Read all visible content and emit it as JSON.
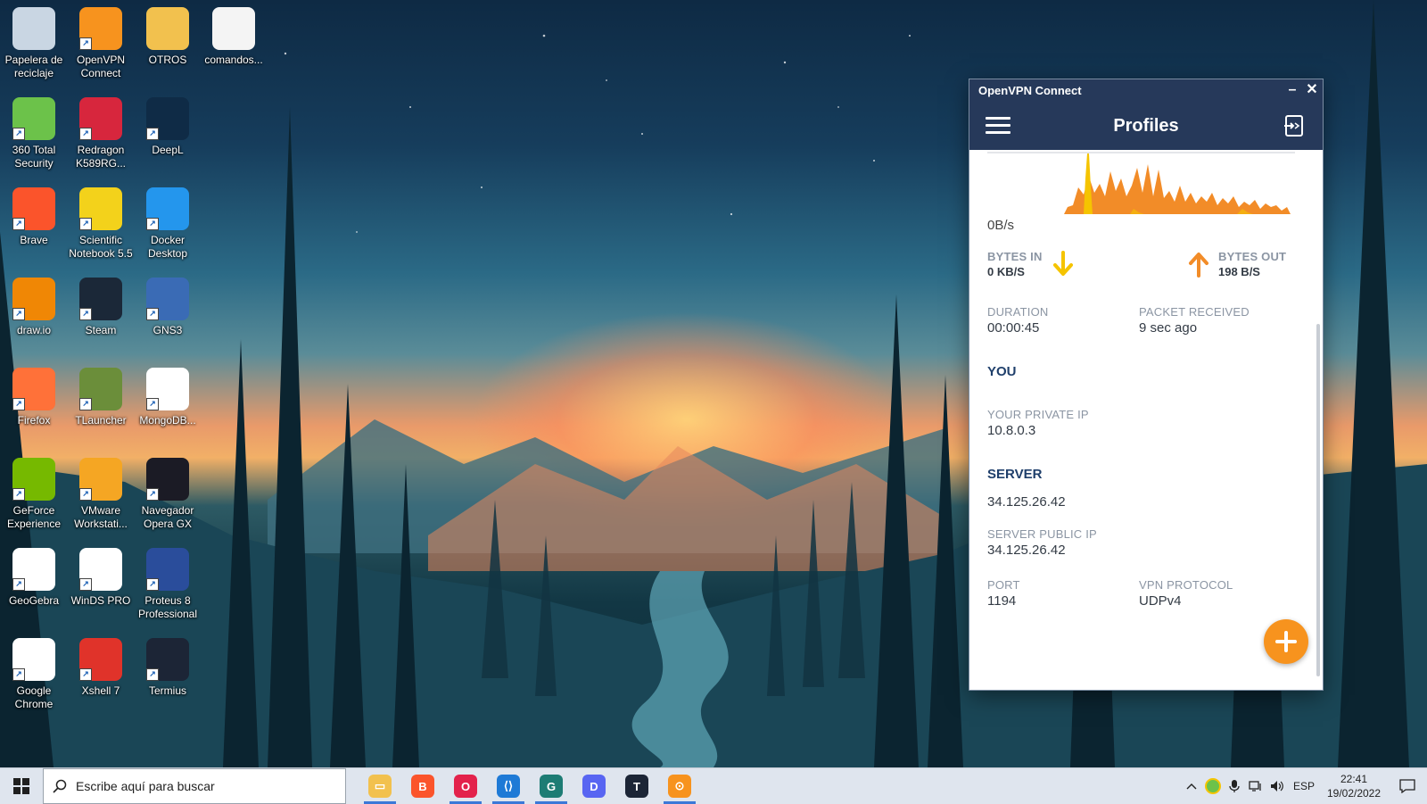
{
  "desktop": {
    "icons": [
      {
        "label": "Papelera de reciclaje",
        "icon": "recycle-bin-icon",
        "color": "#c9d6e3"
      },
      {
        "label": "OpenVPN Connect",
        "icon": "openvpn-icon",
        "color": "#f7931e"
      },
      {
        "label": "OTROS",
        "icon": "folder-icon",
        "color": "#f2c14e"
      },
      {
        "label": "comandos...",
        "icon": "text-file-icon",
        "color": "#f4f4f4"
      },
      {
        "label": "360 Total Security",
        "icon": "security-360-icon",
        "color": "#6cc24a"
      },
      {
        "label": "Redragon K589RG...",
        "icon": "redragon-icon",
        "color": "#d7263d"
      },
      {
        "label": "DeepL",
        "icon": "deepl-icon",
        "color": "#0f2b46"
      },
      {
        "label": "Brave",
        "icon": "brave-icon",
        "color": "#fb542b"
      },
      {
        "label": "Scientific Notebook 5.5",
        "icon": "scientific-notebook-icon",
        "color": "#f3d21b"
      },
      {
        "label": "Docker Desktop",
        "icon": "docker-icon",
        "color": "#2496ed"
      },
      {
        "label": "draw.io",
        "icon": "drawio-icon",
        "color": "#f08705"
      },
      {
        "label": "Steam",
        "icon": "steam-icon",
        "color": "#1b2838"
      },
      {
        "label": "GNS3",
        "icon": "gns3-icon",
        "color": "#3a6bb5"
      },
      {
        "label": "Firefox",
        "icon": "firefox-icon",
        "color": "#ff7139"
      },
      {
        "label": "TLauncher",
        "icon": "minecraft-icon",
        "color": "#6b8e3a"
      },
      {
        "label": "MongoDB...",
        "icon": "mongodb-icon",
        "color": "#ffffff"
      },
      {
        "label": "GeForce Experience",
        "icon": "nvidia-icon",
        "color": "#76b900"
      },
      {
        "label": "VMware Workstati...",
        "icon": "vmware-icon",
        "color": "#f5a623"
      },
      {
        "label": "Navegador Opera GX",
        "icon": "opera-gx-icon",
        "color": "#1b1b25"
      },
      {
        "label": "GeoGebra",
        "icon": "geogebra-icon",
        "color": "#ffffff"
      },
      {
        "label": "WinDS PRO",
        "icon": "winds-pro-icon",
        "color": "#ffffff"
      },
      {
        "label": "Proteus 8 Professional",
        "icon": "proteus-icon",
        "color": "#2a4d9b"
      },
      {
        "label": "Google Chrome",
        "icon": "chrome-icon",
        "color": "#ffffff"
      },
      {
        "label": "Xshell 7",
        "icon": "xshell-icon",
        "color": "#e0332a"
      },
      {
        "label": "Termius",
        "icon": "termius-icon",
        "color": "#1c2536"
      }
    ]
  },
  "vpn": {
    "window_title": "OpenVPN Connect",
    "minimize": "–",
    "close": "✕",
    "header_title": "Profiles",
    "graph_rate_label": "0B/s",
    "bytes_in_label": "BYTES IN",
    "bytes_in_value": "0 KB/S",
    "bytes_out_label": "BYTES OUT",
    "bytes_out_value": "198 B/S",
    "duration_label": "DURATION",
    "duration_value": "00:00:45",
    "packet_label": "PACKET RECEIVED",
    "packet_value": "9 sec ago",
    "you_heading": "YOU",
    "private_ip_label": "YOUR PRIVATE IP",
    "private_ip_value": "10.8.0.3",
    "server_heading": "SERVER",
    "server_value": "34.125.26.42",
    "server_public_ip_label": "SERVER PUBLIC IP",
    "server_public_ip_value": "34.125.26.42",
    "port_label": "PORT",
    "port_value": "1194",
    "protocol_label": "VPN PROTOCOL",
    "protocol_value": "UDPv4",
    "colors": {
      "accent": "#f7931e",
      "header": "#26395a",
      "in_arrow": "#f5c400",
      "out_arrow": "#f28c28"
    }
  },
  "taskbar": {
    "search_placeholder": "Escribe aquí para buscar",
    "apps": [
      {
        "icon": "file-explorer-icon",
        "color": "#f2c14e",
        "glyph": "▭"
      },
      {
        "icon": "brave-icon",
        "color": "#fb542b",
        "glyph": "B"
      },
      {
        "icon": "opera-gx-icon",
        "color": "#e3224b",
        "glyph": "O"
      },
      {
        "icon": "vscode-icon",
        "color": "#1e7ad6",
        "glyph": "⟨⟩"
      },
      {
        "icon": "gitkraken-icon",
        "color": "#1d7c74",
        "glyph": "G"
      },
      {
        "icon": "discord-icon",
        "color": "#5865f2",
        "glyph": "D"
      },
      {
        "icon": "termius-icon",
        "color": "#1c2536",
        "glyph": "T"
      },
      {
        "icon": "openvpn-icon",
        "color": "#f7931e",
        "glyph": "⊙"
      }
    ],
    "language": "ESP",
    "time": "22:41",
    "date": "19/02/2022"
  }
}
